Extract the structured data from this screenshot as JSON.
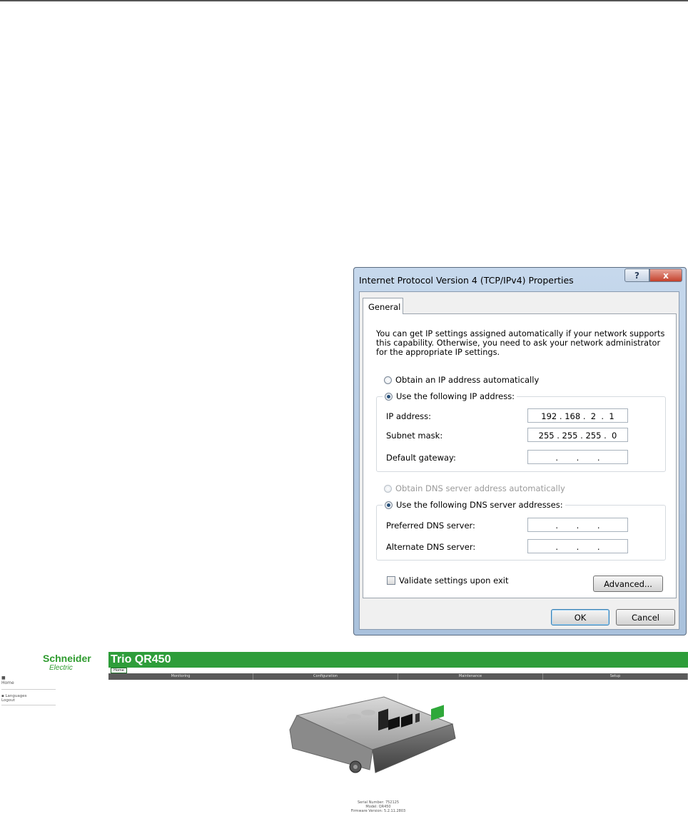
{
  "dialog": {
    "title": "Internet Protocol Version 4 (TCP/IPv4) Properties",
    "help_button": "?",
    "close_button": "x",
    "tab_general": "General",
    "description": "You can get IP settings assigned automatically if your network supports this capability. Otherwise, you need to ask your network administrator for the appropriate IP settings.",
    "ip_auto_label": "Obtain an IP address automatically",
    "ip_manual_label": "Use the following IP address:",
    "ip_address_label": "IP address:",
    "ip_address_value": "192 . 168 .  2  .  1",
    "subnet_label": "Subnet mask:",
    "subnet_value": "255 . 255 . 255 .  0",
    "gateway_label": "Default gateway:",
    "gateway_value": ".       .       .",
    "dns_auto_label": "Obtain DNS server address automatically",
    "dns_manual_label": "Use the following DNS server addresses:",
    "preferred_dns_label": "Preferred DNS server:",
    "preferred_dns_value": ".       .       .",
    "alternate_dns_label": "Alternate DNS server:",
    "alternate_dns_value": ".       .       .",
    "validate_label": "Validate settings upon exit",
    "validate_checked": false,
    "advanced_button": "Advanced...",
    "ok_button": "OK",
    "cancel_button": "Cancel",
    "ip_mode": "manual",
    "dns_mode": "manual"
  },
  "webapp": {
    "brand_name": "Schneider",
    "brand_sub": "Electric",
    "app_title": "Trio QR450",
    "home_tab": "Home",
    "sidebar_home": "Home",
    "sidebar_languages": "Languages",
    "sidebar_logout": "Logout",
    "nav_items": [
      "Monitoring",
      "Configuration",
      "Maintenance",
      "Setup"
    ],
    "serial_line": "Serial Number: 752125",
    "model_line": "Model: QR450",
    "firmware_line": "Firmware Version: 5.2.11.2803",
    "header_color": "#2e9d3a",
    "nav_color": "#5a5a5a"
  }
}
